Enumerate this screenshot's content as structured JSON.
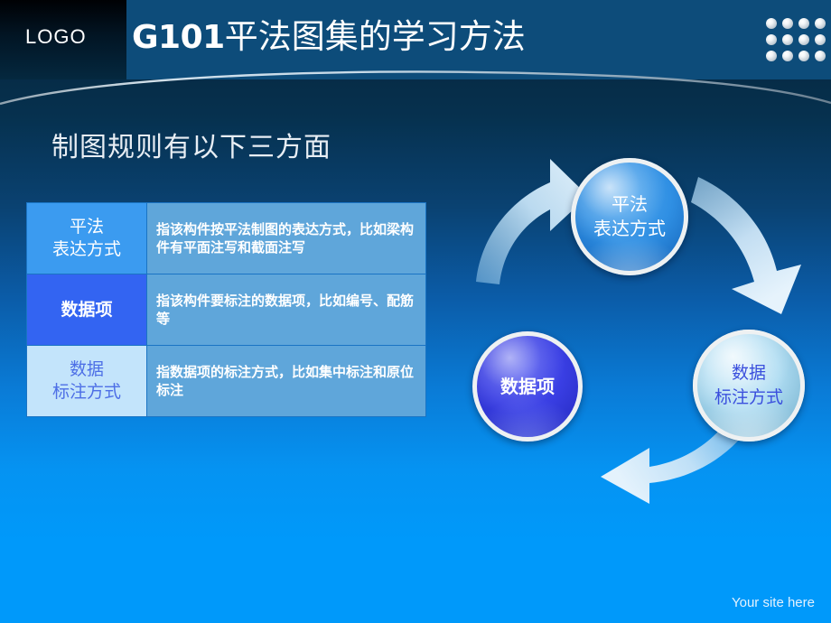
{
  "slide": {
    "background_top_color": "#041d33",
    "background_bottom_color": "#0099fa"
  },
  "header": {
    "logo_label": "LOGO",
    "title_prefix": "G101",
    "title_main": "平法图集的学习方法",
    "bar_color": "#0d4c7a",
    "dots": {
      "columns": 4,
      "rows": 3,
      "color": "#ffffff"
    }
  },
  "body": {
    "subtitle": "制图规则有以下三方面"
  },
  "table": {
    "rows": [
      {
        "key": "平法\n表达方式",
        "key_line1": "平法",
        "key_line2": "表达方式",
        "value": "指该构件按平法制图的表达方式，比如梁构件有平面注写和截面注写",
        "key_bg": "#3b9bf0",
        "key_color": "#ffffff"
      },
      {
        "key": "数据项",
        "key_line1": "数据项",
        "key_line2": "",
        "value": "指该构件要标注的数据项，比如编号、配筋等",
        "key_bg": "#3364f2",
        "key_color": "#ffffff"
      },
      {
        "key": "数据\n标注方式",
        "key_line1": "数据",
        "key_line2": "标注方式",
        "value": "指数据项的标注方式，比如集中标注和原位标注",
        "key_bg": "#c3e4fb",
        "key_color": "#4d6fe6"
      }
    ],
    "value_bg": "#5fa6da"
  },
  "diagram": {
    "type": "cycle",
    "direction": "clockwise",
    "nodes": [
      {
        "id": "top",
        "line1": "平法",
        "line2": "表达方式",
        "color": "#2f8fe3",
        "text_color": "#ffffff"
      },
      {
        "id": "right",
        "line1": "数据",
        "line2": "标注方式",
        "color": "#aedcf2",
        "text_color": "#3a4fdd"
      },
      {
        "id": "left",
        "line1": "数据项",
        "line2": "",
        "color": "#3a3fe4",
        "text_color": "#ffffff"
      }
    ],
    "arrow_color": "#bdddf4"
  },
  "footer": {
    "site_note": "Your site here"
  }
}
